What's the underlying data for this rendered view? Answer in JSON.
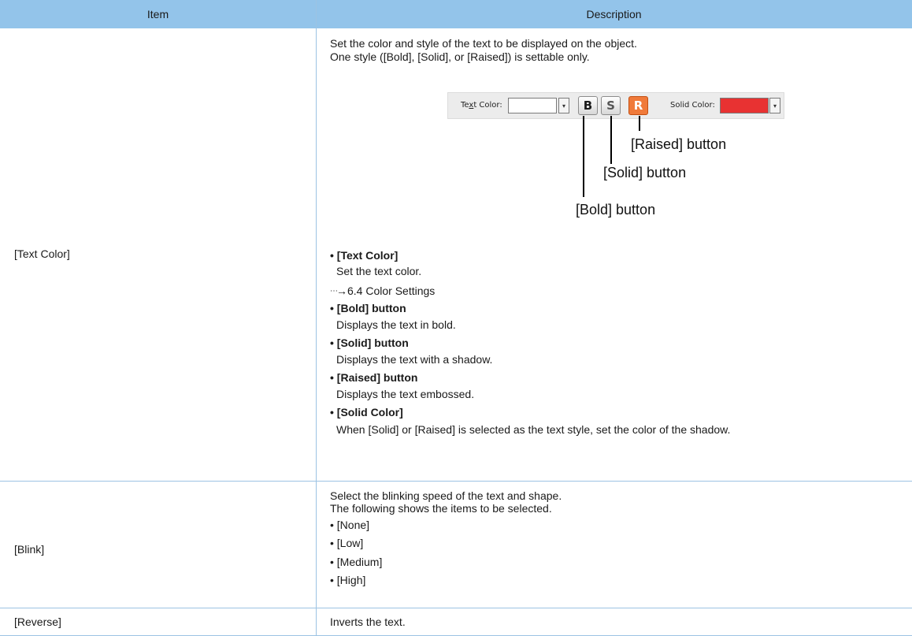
{
  "header": {
    "item": "Item",
    "description": "Description"
  },
  "text_color": {
    "item": "[Text Color]",
    "intro1": "Set the color and style of the text to be displayed on the object.",
    "intro2": "One style ([Bold], [Solid], or [Raised]) is settable only.",
    "toolbar": {
      "text_color_label_pre": "Te",
      "text_color_label_ul": "x",
      "text_color_label_post": "t Color:",
      "bold_glyph": "B",
      "solid_glyph": "S",
      "raised_glyph": "R",
      "solid_color_label": "Solid Color:",
      "dropdown_glyph": "▾",
      "solid_color_value": "#e83232",
      "raised_fill": "#f07a3a"
    },
    "callout_raised": "[Raised] button",
    "callout_solid": "[Solid] button",
    "callout_bold": "[Bold] button",
    "bullets": [
      {
        "title": "• [Text Color]",
        "desc": "Set the text color."
      },
      {
        "title": "• [Bold] button",
        "desc": "Displays the text in bold."
      },
      {
        "title": "• [Solid] button",
        "desc": "Displays the text with a shadow."
      },
      {
        "title": "• [Raised] button",
        "desc": "Displays the text embossed."
      },
      {
        "title": "• [Solid Color]",
        "desc": "When [Solid] or [Raised] is selected as the text style, set the color of the shadow."
      }
    ],
    "ref_arrow": "→",
    "ref_text": "6.4 Color Settings"
  },
  "blink": {
    "item": "[Blink]",
    "line1": "Select the blinking speed of the text and shape.",
    "line2": "The following shows the items to be selected.",
    "options": [
      "• [None]",
      "• [Low]",
      "• [Medium]",
      "• [High]"
    ]
  },
  "reverse": {
    "item": "[Reverse]",
    "desc": "Inverts the text."
  }
}
